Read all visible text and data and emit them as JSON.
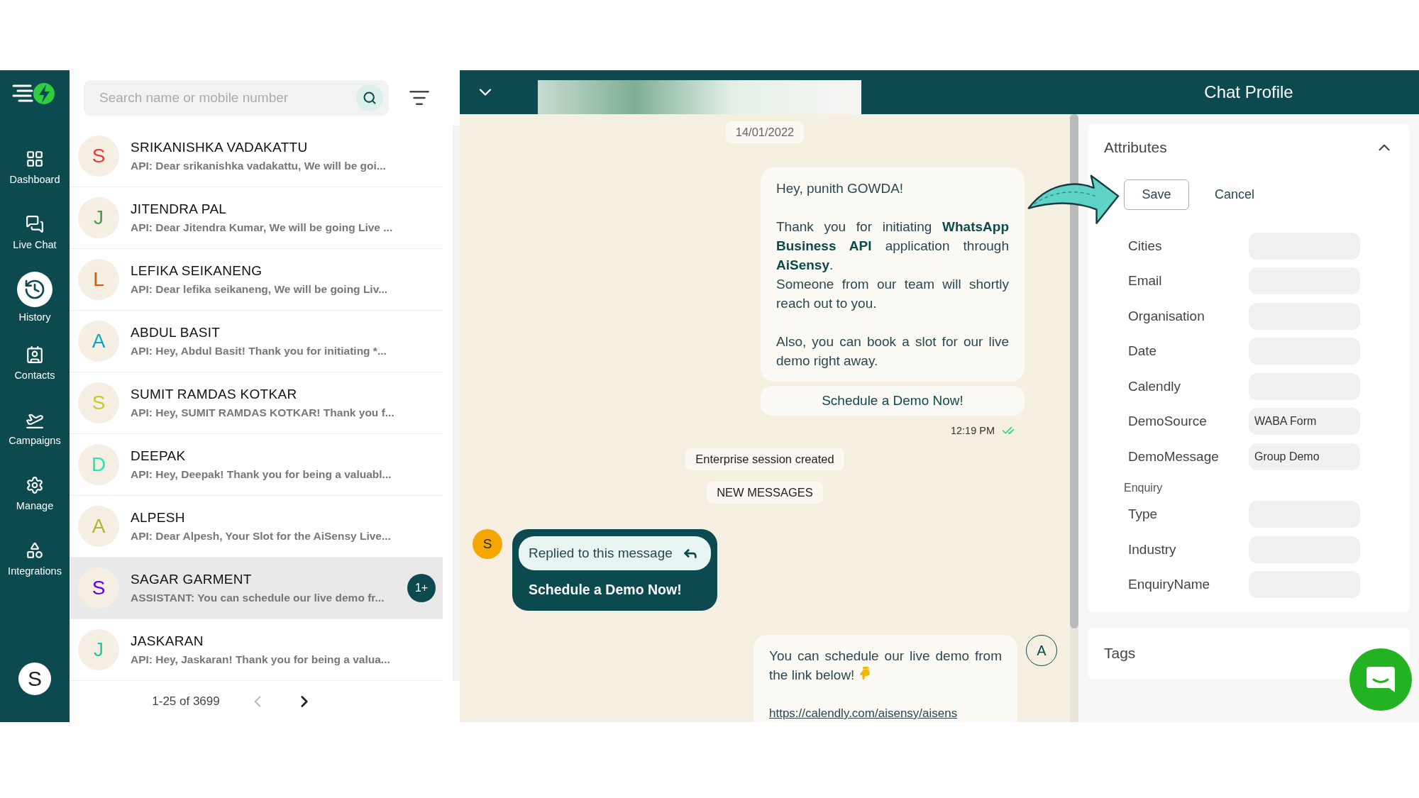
{
  "sidebar": {
    "items": [
      {
        "label": "Dashboard",
        "selected": false
      },
      {
        "label": "Live Chat",
        "selected": false
      },
      {
        "label": "History",
        "selected": true
      },
      {
        "label": "Contacts",
        "selected": false
      },
      {
        "label": "Campaigns",
        "selected": false
      },
      {
        "label": "Manage",
        "selected": false
      },
      {
        "label": "Integrations",
        "selected": false
      }
    ],
    "user_initial": "S"
  },
  "chat_list": {
    "search": {
      "placeholder": "Search name or mobile number"
    },
    "chats": [
      {
        "initial": "S",
        "color": "#e53935",
        "name": "SRIKANISHKA VADAKATTU",
        "preview": "API: Dear srikanishka vadakattu, We will be goi...",
        "selected": false
      },
      {
        "initial": "J",
        "color": "#43a047",
        "name": "JITENDRA PAL",
        "preview": "API: Dear Jitendra Kumar, We will be going Live ...",
        "selected": false
      },
      {
        "initial": "L",
        "color": "#e65100",
        "name": "LEFIKA SEIKANENG",
        "preview": "API: Dear lefika seikaneng, We will be going Liv...",
        "selected": false
      },
      {
        "initial": "A",
        "color": "#00acc1",
        "name": "ABDUL BASIT",
        "preview": "API: Hey, Abdul Basit! Thank you for initiating *...",
        "selected": false
      },
      {
        "initial": "S",
        "color": "#c0ca33",
        "name": "SUMIT RAMDAS KOTKAR",
        "preview": "API: Hey, SUMIT RAMDAS KOTKAR! Thank you f...",
        "selected": false
      },
      {
        "initial": "D",
        "color": "#1de9b6",
        "name": "DEEPAK",
        "preview": "API: Hey, Deepak! Thank you for being a valuabl...",
        "selected": false
      },
      {
        "initial": "A",
        "color": "#afb42b",
        "name": "ALPESH",
        "preview": "API: Dear Alpesh, Your Slot for the AiSensy Live...",
        "selected": false
      },
      {
        "initial": "S",
        "color": "#6200ea",
        "name": "SAGAR GARMENT",
        "preview": "ASSISTANT: You can schedule our live demo fr...",
        "selected": true,
        "badge": "1+"
      },
      {
        "initial": "J",
        "color": "#26c6a0",
        "name": "JASKARAN",
        "preview": "API: Hey, Jaskaran! Thank you for being a valua...",
        "selected": false
      }
    ],
    "pagination": {
      "range": "1-25 of 3699",
      "prev_disabled": true,
      "next_disabled": false
    }
  },
  "conversation": {
    "date": "14/01/2022",
    "messages": [
      {
        "kind": "outgoing",
        "paragraphs": [
          [
            "Hey, punith GOWDA!"
          ],
          [
            "Thank you for initiating **WhatsApp Business API** application through **AiSensy**.",
            "Someone from our team will shortly reach out to you."
          ],
          [
            "Also, you can book a slot for our live demo right away."
          ]
        ],
        "button": "Schedule a Demo Now!",
        "time": "12:19 PM"
      },
      {
        "kind": "system",
        "text": "Enterprise session created"
      },
      {
        "kind": "system",
        "text": "NEW MESSAGES"
      },
      {
        "kind": "incoming_reply",
        "initial": "S",
        "reply_label": "Replied to this message",
        "text": "Schedule a Demo Now!"
      },
      {
        "kind": "outgoing",
        "agent_initial": "A",
        "paragraphs": [
          [
            "You can schedule our live demo from the link below!"
          ],
          [
            "https://calendly.com/aisensy/aisens"
          ]
        ]
      }
    ]
  },
  "profile": {
    "title": "Chat Profile",
    "attributes": {
      "title": "Attributes",
      "expanded": true,
      "save": "Save",
      "cancel": "Cancel",
      "rows": [
        {
          "kind": "field",
          "label": "Cities"
        },
        {
          "kind": "field",
          "label": "Email"
        },
        {
          "kind": "field",
          "label": "Organisation"
        },
        {
          "kind": "field",
          "label": "Date"
        },
        {
          "kind": "field",
          "label": "Calendly"
        },
        {
          "kind": "field",
          "label": "DemoSource",
          "value": "WABA Form"
        },
        {
          "kind": "field",
          "label": "DemoMessage",
          "value": "Group Demo"
        },
        {
          "kind": "heading",
          "label": "Enquiry"
        },
        {
          "kind": "field",
          "label": "Type"
        },
        {
          "kind": "field",
          "label": "Industry"
        },
        {
          "kind": "field",
          "label": "EnquiryName"
        }
      ]
    },
    "tags": {
      "title": "Tags"
    }
  }
}
